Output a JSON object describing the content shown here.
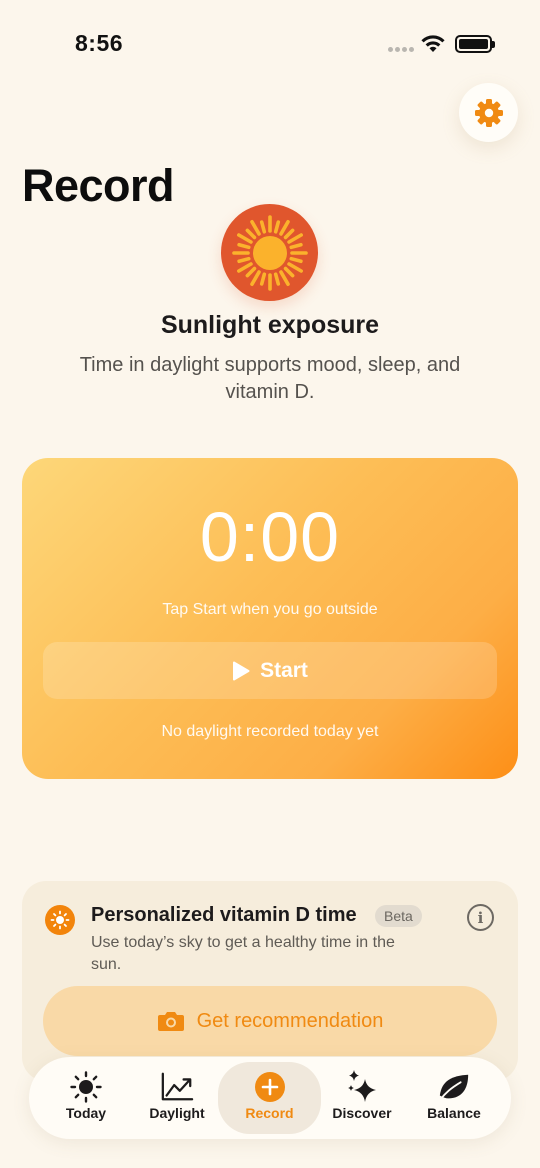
{
  "status_bar": {
    "time": "8:56"
  },
  "page": {
    "title": "Record"
  },
  "feature": {
    "title": "Sunlight exposure",
    "description": "Time in daylight supports mood, sleep, and vitamin D."
  },
  "timer": {
    "value": "0:00",
    "hint": "Tap Start when you go outside",
    "start_label": "Start",
    "status": "No daylight recorded today yet"
  },
  "vitamin_card": {
    "title": "Personalized vitamin D time",
    "badge": "Beta",
    "description": "Use today’s sky to get a healthy time in the sun.",
    "button_label": "Get recommendation"
  },
  "tabs": [
    {
      "label": "Today",
      "icon": "sun-icon"
    },
    {
      "label": "Daylight",
      "icon": "chart-trend-icon"
    },
    {
      "label": "Record",
      "icon": "plus-circle-icon",
      "active": true
    },
    {
      "label": "Discover",
      "icon": "sparkles-icon"
    },
    {
      "label": "Balance",
      "icon": "leaf-icon"
    }
  ],
  "colors": {
    "background": "#fcf6ec",
    "accent": "#f08a12",
    "sun_badge": "#e0562d",
    "card_gradient_start": "#fdd779",
    "card_gradient_end": "#fd8f17"
  }
}
